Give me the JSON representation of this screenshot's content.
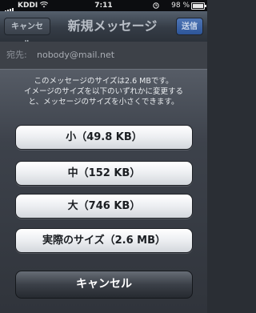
{
  "status_bar": {
    "carrier": "KDDI",
    "time": "7:11",
    "battery": "98 %",
    "battery_level": 0.98
  },
  "nav": {
    "cancel_label": "キャンセル",
    "title": "新規メッセージ",
    "send_label": "送信"
  },
  "compose": {
    "to_label": "宛先:",
    "to_value": "nobody@mail.net"
  },
  "sheet": {
    "message_lines": [
      "このメッセージのサイズは2.6 MBです。",
      "イメージのサイズを以下のいずれかに変更する",
      "と、メッセージのサイズを小さくできます。"
    ],
    "options": [
      "小（49.8 KB）",
      "中（152 KB）",
      "大（746 KB）",
      "実際のサイズ（2.6 MB）"
    ],
    "cancel_label": "キャンセル"
  }
}
